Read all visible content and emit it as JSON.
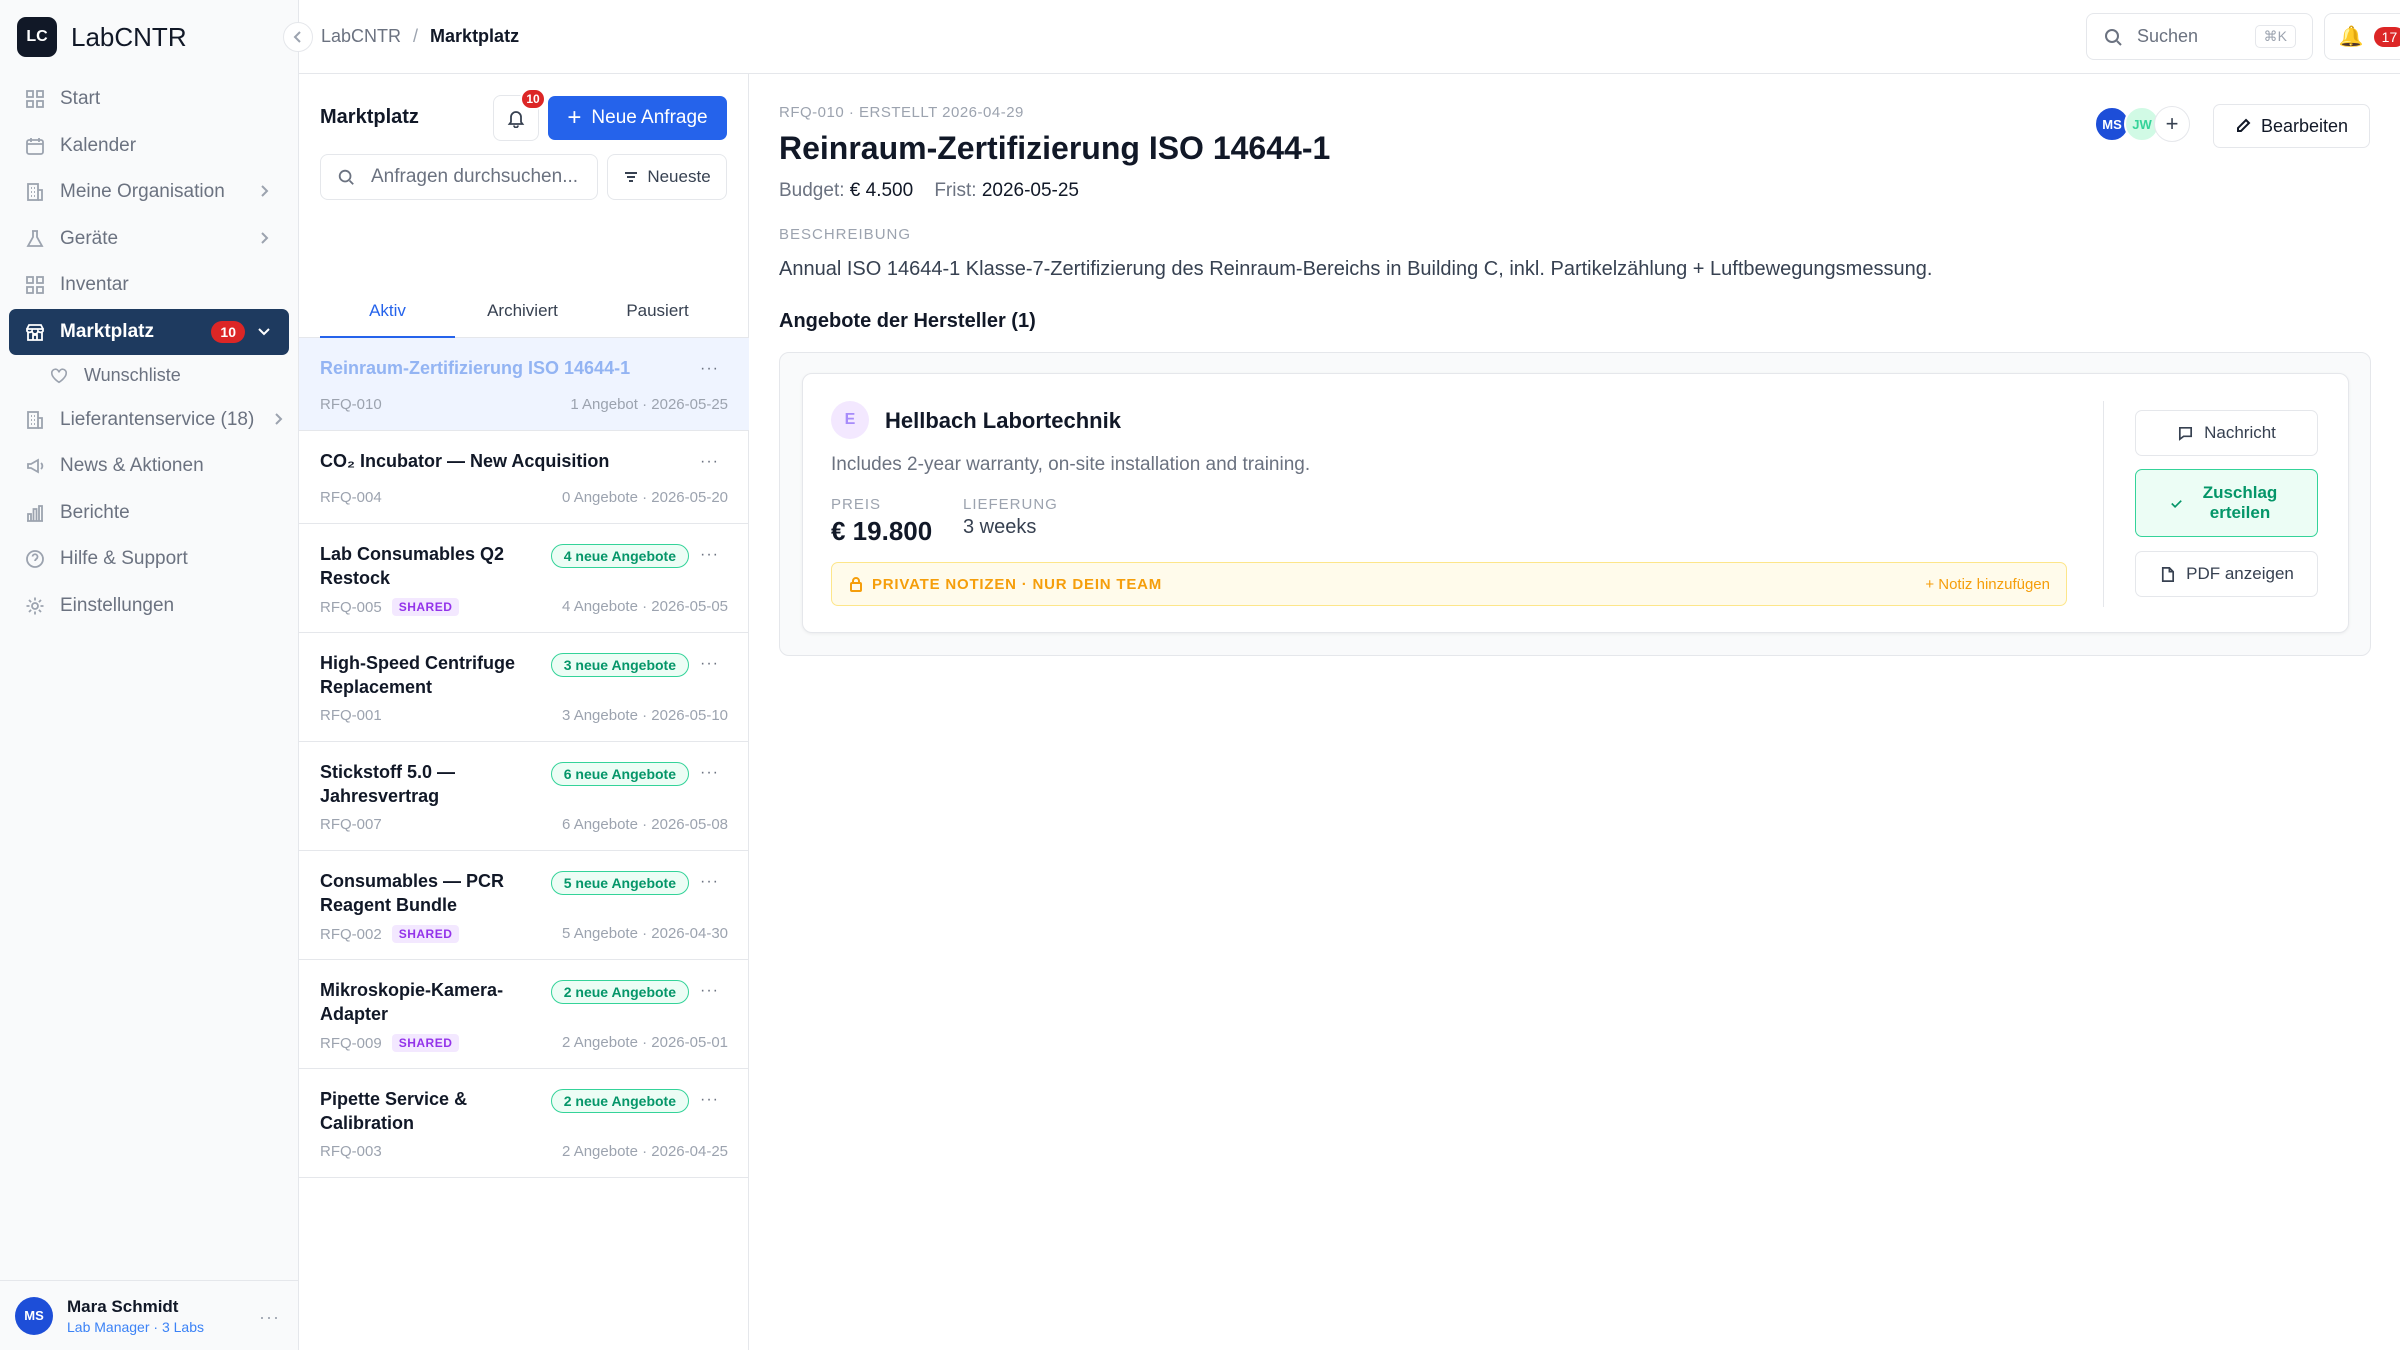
{
  "brand": {
    "logo": "LC",
    "name": "LabCNTR"
  },
  "sidebar": {
    "items": [
      {
        "label": "Start",
        "icon": "grid-icon"
      },
      {
        "label": "Kalender",
        "icon": "calendar-icon"
      },
      {
        "label": "Meine Organisation",
        "icon": "building-icon"
      },
      {
        "label": "Geräte",
        "icon": "flask-icon"
      },
      {
        "label": "Inventar",
        "icon": "grid-icon"
      },
      {
        "label": "Marktplatz",
        "icon": "store-icon",
        "badge": "10"
      },
      {
        "label": "Wunschliste",
        "icon": "heart-icon"
      },
      {
        "label": "Lieferantenservice (18)",
        "icon": "building-icon"
      },
      {
        "label": "News & Aktionen",
        "icon": "megaphone-icon"
      },
      {
        "label": "Berichte",
        "icon": "bar-chart-icon"
      },
      {
        "label": "Hilfe & Support",
        "icon": "help-icon"
      },
      {
        "label": "Einstellungen",
        "icon": "gear-icon"
      }
    ],
    "user": {
      "initials": "MS",
      "name": "Mara Schmidt",
      "role": "Lab Manager · 3 Labs",
      "more": "···"
    }
  },
  "topbar": {
    "crumb_root": "LabCNTR",
    "crumb_sep": "/",
    "crumb_current": "Marktplatz",
    "search_label": "Suchen",
    "search_kbd": "⌘K",
    "notifications": "17"
  },
  "list": {
    "title": "Marktplatz",
    "bell_badge": "10",
    "new_button": "Neue Anfrage",
    "search_placeholder": "Anfragen durchsuchen...",
    "sort_label": "Neueste",
    "tabs": [
      "Aktiv",
      "Archiviert",
      "Pausiert"
    ],
    "rows": [
      {
        "title": "Reinraum-Zertifizierung ISO 14644-1",
        "id": "RFQ-010",
        "meta": "1 Angebot · 2026-05-25",
        "badge": "",
        "shared": ""
      },
      {
        "title": "CO₂ Incubator — New Acquisition",
        "id": "RFQ-004",
        "meta": "0 Angebote · 2026-05-20",
        "badge": "",
        "shared": ""
      },
      {
        "title": "Lab Consumables Q2 Restock",
        "id": "RFQ-005",
        "meta": "4 Angebote · 2026-05-05",
        "badge": "4 neue Angebote",
        "shared": "SHARED"
      },
      {
        "title": "High-Speed Centrifuge Replacement",
        "id": "RFQ-001",
        "meta": "3 Angebote · 2026-05-10",
        "badge": "3 neue Angebote",
        "shared": ""
      },
      {
        "title": "Stickstoff 5.0 — Jahresvertrag",
        "id": "RFQ-007",
        "meta": "6 Angebote · 2026-05-08",
        "badge": "6 neue Angebote",
        "shared": ""
      },
      {
        "title": "Consumables — PCR Reagent Bundle",
        "id": "RFQ-002",
        "meta": "5 Angebote · 2026-04-30",
        "badge": "5 neue Angebote",
        "shared": "SHARED"
      },
      {
        "title": "Mikroskopie-Kamera-Adapter",
        "id": "RFQ-009",
        "meta": "2 Angebote · 2026-05-01",
        "badge": "2 neue Angebote",
        "shared": "SHARED"
      },
      {
        "title": "Pipette Service & Calibration",
        "id": "RFQ-003",
        "meta": "2 Angebote · 2026-04-25",
        "badge": "2 neue Angebote",
        "shared": ""
      }
    ],
    "more": "···"
  },
  "detail": {
    "meta": "RFQ-010 · ERSTELLT 2026-04-29",
    "title": "Reinraum-Zertifizierung ISO 14644-1",
    "budget_label": "Budget:",
    "budget_value": "€ 4.500",
    "deadline_label": "Frist:",
    "deadline_value": "2026-05-25",
    "avatars": [
      "MS",
      "JW"
    ],
    "add_avatar": "+",
    "edit_button": "Bearbeiten",
    "description_label": "BESCHREIBUNG",
    "description": "Annual ISO 14644-1 Klasse-7-Zertifizierung des Reinraum-Bereichs in Building C, inkl. Partikelzählung + Luftbewegungsmessung.",
    "offers_heading": "Angebote der Hersteller (1)",
    "offer": {
      "avatar": "E",
      "vendor": "Hellbach Labortechnik",
      "note": "Includes 2-year warranty, on-site installation and training.",
      "price_label": "PREIS",
      "price": "€ 19.800",
      "delivery_label": "LIEFERUNG",
      "delivery": "3 weeks",
      "private_notes": "PRIVATE NOTIZEN · NUR DEIN TEAM",
      "add_note": "+ Notiz hinzufügen",
      "message_button": "Nachricht",
      "award_button": "Zuschlag erteilen",
      "pdf_button": "PDF anzeigen"
    }
  }
}
